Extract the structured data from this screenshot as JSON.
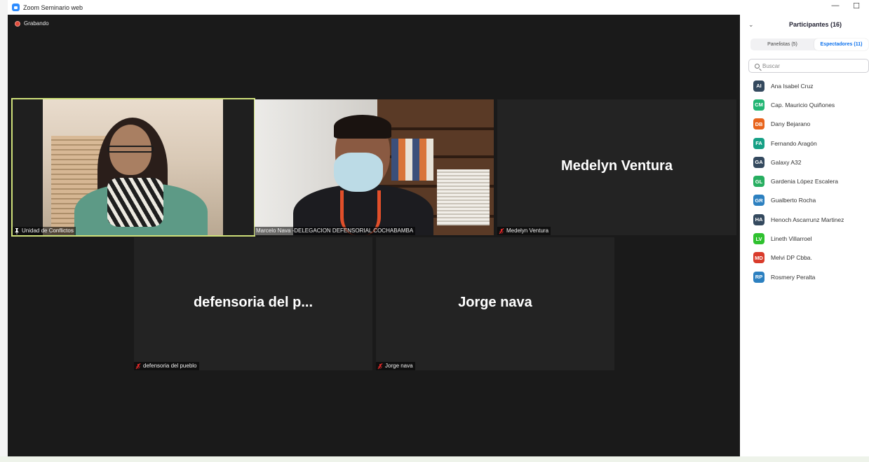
{
  "window": {
    "title": "Zoom Seminario web",
    "minimize": "—",
    "maximize": "☐"
  },
  "recording": {
    "label": "Grabando",
    "color": "#e04a3a"
  },
  "tiles": [
    {
      "name": "Unidad de Conflictos",
      "icon": "pin-icon",
      "active_speaker": true
    },
    {
      "name": "Marcelo Nava -DELEGACION DEFENSORIAL COCHABAMBA",
      "icon": null
    },
    {
      "name": "Medelyn Ventura",
      "display": "Medelyn Ventura",
      "icon": "muted-mic-icon"
    },
    {
      "name": "defensoria del pueblo",
      "display": "defensoria  del  p...",
      "icon": "muted-mic-icon"
    },
    {
      "name": "Jorge nava",
      "display": "Jorge nava",
      "icon": "muted-mic-icon"
    }
  ],
  "participants_panel": {
    "title": "Participantes (16)",
    "tabs": [
      {
        "label": "Panelistas (5)"
      },
      {
        "label": "Espectadores (11)",
        "selected": true
      }
    ],
    "search_placeholder": "Buscar",
    "attendees": [
      {
        "initials": "AI",
        "name": "Ana Isabel Cruz",
        "color": "#34495e"
      },
      {
        "initials": "CM",
        "name": "Cap. Mauricio Quiñones",
        "color": "#22b573"
      },
      {
        "initials": "DB",
        "name": "Dany Bejarano",
        "color": "#e8641c"
      },
      {
        "initials": "FA",
        "name": "Fernando Aragón",
        "color": "#16a085"
      },
      {
        "initials": "GA",
        "name": "Galaxy A32",
        "color": "#34495e"
      },
      {
        "initials": "GL",
        "name": "Gardenia López Escalera",
        "color": "#27ae60"
      },
      {
        "initials": "GR",
        "name": "Gualberto Rocha",
        "color": "#2c80c0"
      },
      {
        "initials": "HA",
        "name": "Henoch Ascarrunz Martinez",
        "color": "#34495e"
      },
      {
        "initials": "LV",
        "name": "Lineth Villarroel",
        "color": "#2fc12f"
      },
      {
        "initials": "MD",
        "name": "Melvi DP Cbba.",
        "color": "#d93b2b"
      },
      {
        "initials": "RP",
        "name": "Rosmery Peralta",
        "color": "#2c80c0"
      }
    ]
  },
  "colors": {
    "active_speaker_border": "#cfe07a",
    "tab_accent": "#0e72ed",
    "video_bg": "#1a1a1a"
  }
}
